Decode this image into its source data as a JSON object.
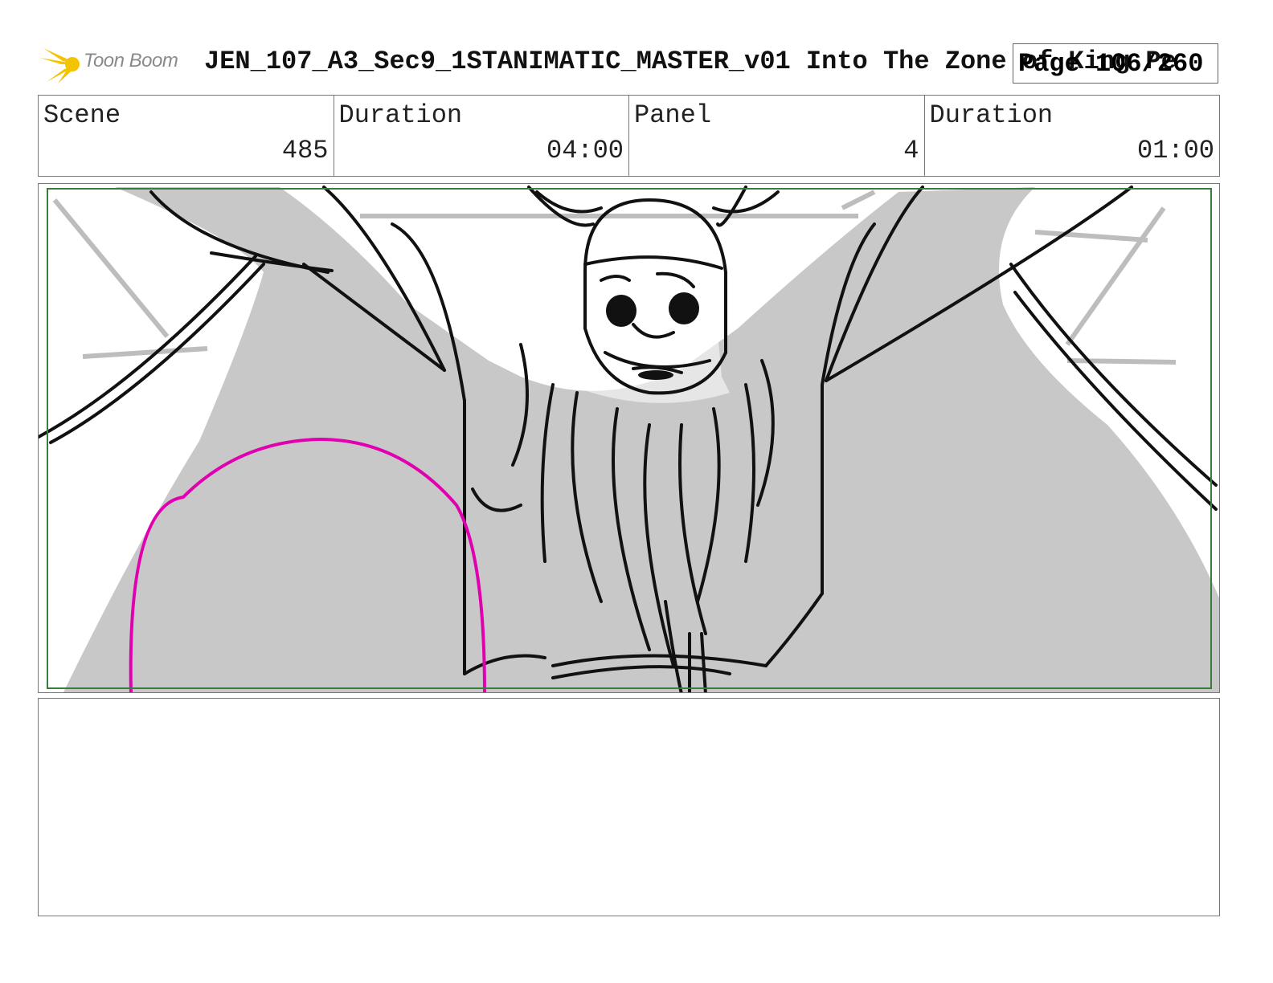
{
  "header": {
    "logo_text": "Toon Boom",
    "logo_color": "#f5c400",
    "title": "JEN_107_A3_Sec9_1STANIMATIC_MASTER_v01  Into The Zone of King Pe",
    "page_label": "Page 106/260"
  },
  "info": {
    "scene_label": "Scene",
    "scene_value": "485",
    "scene_duration_label": "Duration",
    "scene_duration_value": "04:00",
    "panel_label": "Panel",
    "panel_value": "4",
    "panel_duration_label": "Duration",
    "panel_duration_value": "01:00"
  },
  "panel": {
    "safe_frame_color": "#3a7d3a",
    "shadow_color": "#c8c8c8",
    "guide_color": "#e000b0"
  },
  "notes": {
    "text": ""
  }
}
